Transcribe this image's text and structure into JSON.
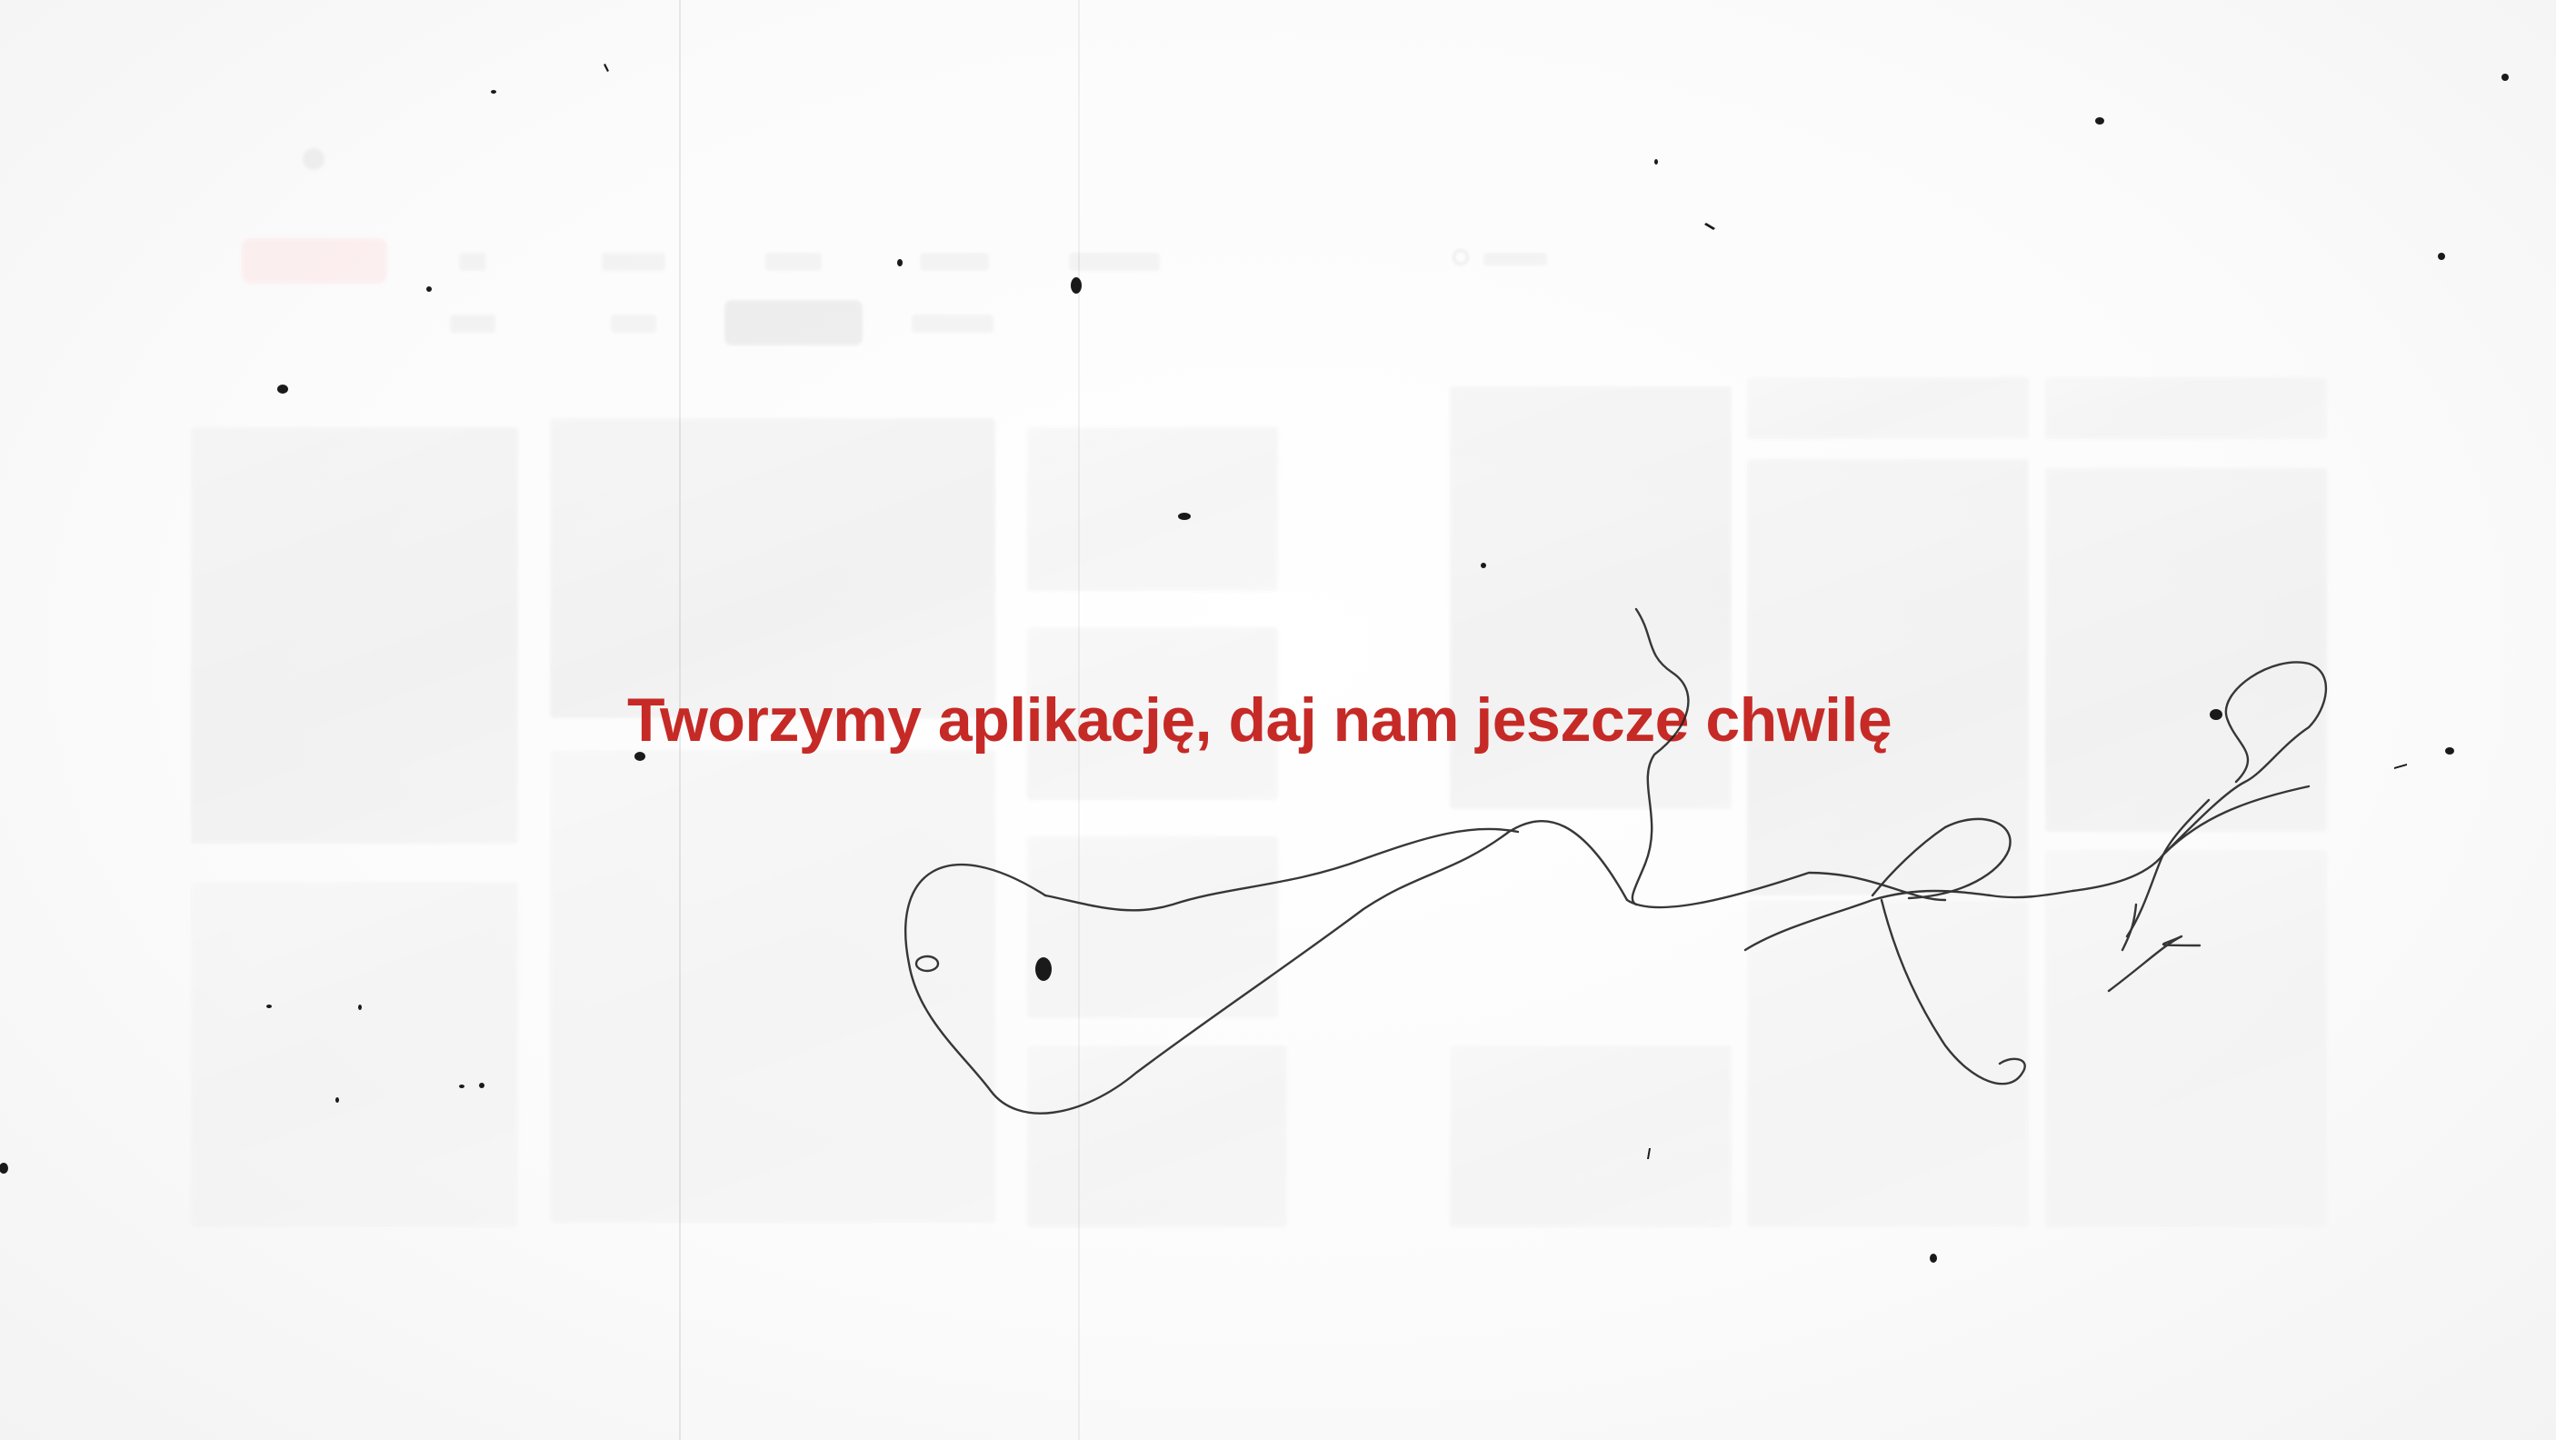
{
  "loading": {
    "message": "Tworzymy aplikację, daj nam jeszcze chwilę"
  },
  "colors": {
    "accent": "#c62a26",
    "background": "#ffffff",
    "speck": "#1a1a1a",
    "ghost_accent": "#fde6e6"
  },
  "icons": {
    "search": "search-icon"
  }
}
